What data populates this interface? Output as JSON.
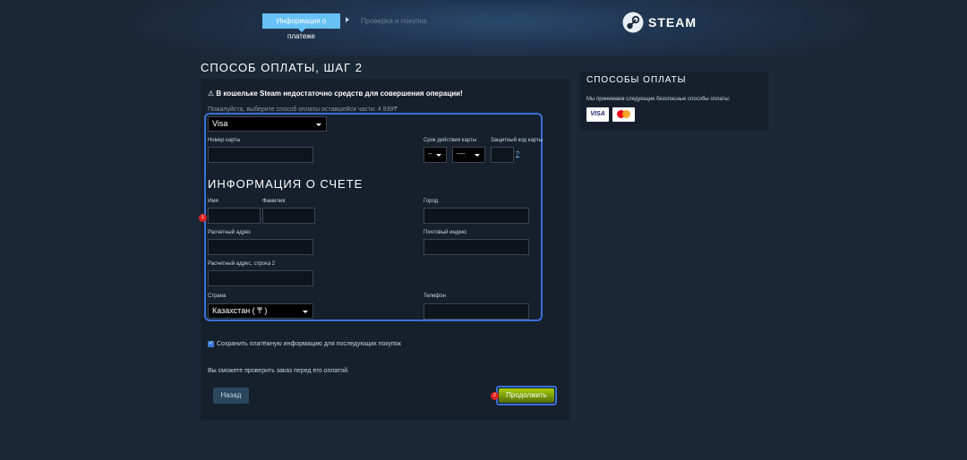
{
  "header": {
    "steps": [
      {
        "label": "Информация о платеже",
        "active": true
      },
      {
        "label": "Проверка и покупка",
        "active": false
      }
    ],
    "logo_text": "STEAM"
  },
  "page_title": "СПОСОБ ОПЛАТЫ, ШАГ 2",
  "warning": {
    "icon": "warning-icon",
    "text": "В кошельке Steam недостаточно средств для совершения операции!"
  },
  "instruction": "Пожалуйста, выберите способ оплаты оставшейся части: 4 939₸",
  "payment_method": {
    "selected": "Visa"
  },
  "card": {
    "number_label": "Номер карты",
    "expiry_label": "Срок действия карты",
    "expiry_month": "--",
    "expiry_year": "----",
    "cvv_label": "Защитный код карты",
    "cvv_help": "?"
  },
  "billing": {
    "heading": "ИНФОРМАЦИЯ О СЧЕТЕ",
    "first_name_label": "Имя",
    "last_name_label": "Фамилия",
    "city_label": "Город",
    "address_label": "Расчетный адрес",
    "zip_label": "Почтовый индекс",
    "address2_label": "Расчетный адрес, строка 2",
    "country_label": "Страна",
    "country_selected": "Казахстан ( ₸ )",
    "phone_label": "Телефон"
  },
  "markers": {
    "first": "1",
    "second": "2"
  },
  "save_info": {
    "checked": true,
    "label": "Сохранить платёжную информацию для последующих покупок"
  },
  "review_note": "Вы сможете проверить заказ перед его оплатой.",
  "buttons": {
    "back": "Назад",
    "continue": "Продолжить"
  },
  "sidebar": {
    "title": "СПОСОБЫ ОПЛАТЫ",
    "text": "Мы принимаем следующие безопасные способы оплаты:",
    "cards": [
      {
        "name": "visa",
        "label": "VISA"
      },
      {
        "name": "mastercard",
        "label": "mastercard"
      }
    ]
  },
  "colors": {
    "background": "#1b2838",
    "panel": "#16202d",
    "accent_blue": "#67c1f5",
    "highlight_border": "#3b6fd8",
    "continue_green": "#a4d007",
    "marker_red": "#e02020"
  }
}
